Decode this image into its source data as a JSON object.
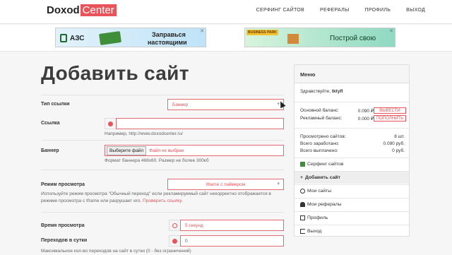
{
  "header": {
    "logo_left": "Doxod",
    "logo_right": "Center",
    "nav": [
      "СЕРФИНГ САЙТОВ",
      "РЕФЕРАЛЫ",
      "ПРОФИЛЬ",
      "ВЫХОД"
    ]
  },
  "ads": {
    "ad1_brand": "АЗС",
    "ad1_text1": "Заправься",
    "ad1_text2": "настоящими",
    "ad2_tag": "BUSINESS PARK",
    "ad2_text": "Построй свою"
  },
  "page": {
    "title": "Добавить сайт"
  },
  "form": {
    "link_type_label": "Тип ссылки",
    "link_type_value": "Баннер",
    "link_label": "Ссылка",
    "link_value": "",
    "link_help": "Например, http://www.doxodcenter.ru/",
    "banner_label": "Баннер",
    "banner_button": "Выберите файл",
    "banner_status": "Файл не выбран",
    "banner_help": "Формат баннера 468x60. Размер не более 300кб",
    "mode_label": "Режим просмотра",
    "mode_value": "Iframe с таймером",
    "mode_help1": "Используйте режим просмотра \"Обычный переход\" если рекламируемый сайт некорректно отображается в",
    "mode_help2": "режиме просмотра с Iframe или разрушает его.",
    "mode_help_link": "Проверить ссылку",
    "time_label": "Время просмотра",
    "time_value": "5 секунд",
    "transitions_label": "Переходов в сутки",
    "transitions_value": "0",
    "transitions_help": "Максимальное кол-во переходов на сайт в сутки (0 - без ограничений)"
  },
  "sidebar": {
    "title": "Меню",
    "greeting": "Здравствуйте,",
    "username": "tktyfl",
    "main_balance_label": "Основной баланс:",
    "main_balance_value": "0.090 ₽",
    "withdraw_button": "ВЫВЕСТИ",
    "ad_balance_label": "Рекламный баланс:",
    "ad_balance_value": "0.000 ₽",
    "topup_button": "ПОПОЛНИТЬ",
    "sites_viewed_label": "Просмотрено сайтов:",
    "sites_viewed_value": "8 шт.",
    "earned_label": "Всего заработано:",
    "earned_value": "0.090 руб.",
    "paid_label": "Всего выплачено:",
    "paid_value": "0 руб.",
    "menu": [
      "Серфинг сайтов",
      "Добавить сайт",
      "Мои сайты",
      "Мои рефералы",
      "Профиль",
      "Выход"
    ]
  },
  "colors": {
    "accent": "#e8545a",
    "text": "#333333"
  }
}
